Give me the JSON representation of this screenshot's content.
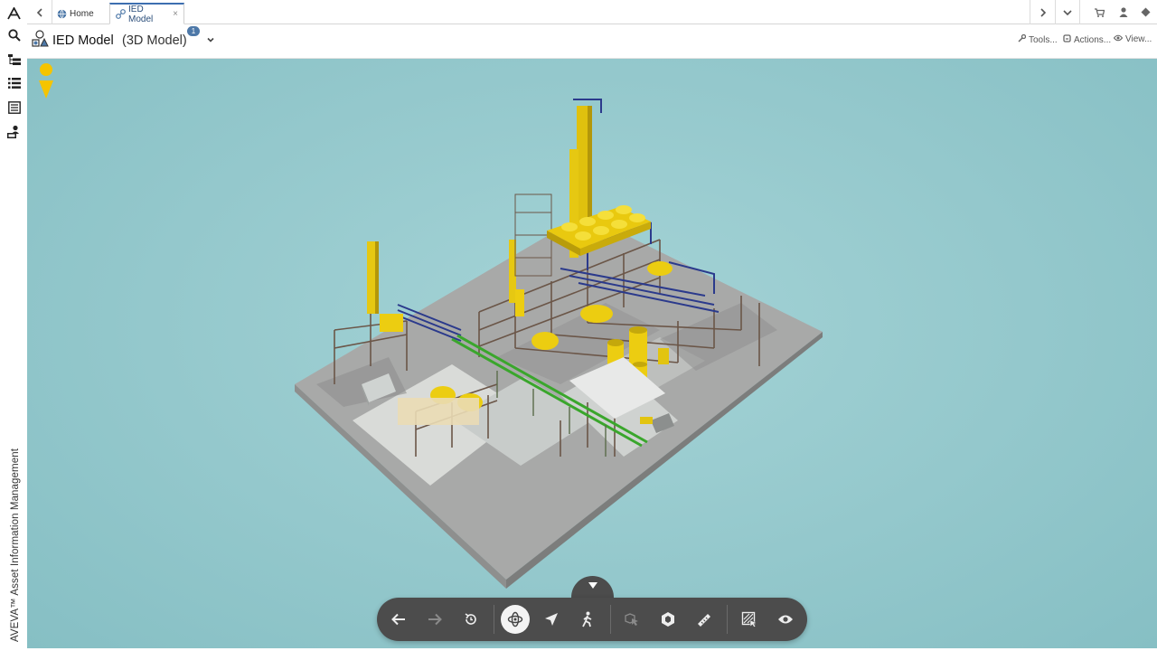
{
  "app": {
    "vertical_brand": "AVEVA™ Asset Information Management"
  },
  "tabs": [
    {
      "label": "Home",
      "icon": "globe-icon",
      "active": false
    },
    {
      "label": "IED Model",
      "icon": "model-link-icon",
      "active": true,
      "close": "×"
    }
  ],
  "header": {
    "title": "IED Model",
    "subtitle": "(3D Model)",
    "badge": "1",
    "menus": {
      "tools": "Tools...",
      "actions": "Actions...",
      "view": "View..."
    }
  },
  "rail_icons": [
    "aveva-logo-icon",
    "search-icon",
    "hierarchy-icon",
    "list-icon",
    "document-list-icon",
    "user-document-icon"
  ],
  "toolbar": {
    "buttons": [
      {
        "name": "back-icon",
        "active": false,
        "enabled": true
      },
      {
        "name": "forward-icon",
        "active": false,
        "enabled": false
      },
      {
        "name": "reset-view-icon",
        "active": false,
        "enabled": true
      },
      {
        "name": "orbit-icon",
        "active": true,
        "enabled": true
      },
      {
        "name": "fly-icon",
        "active": false,
        "enabled": true
      },
      {
        "name": "walk-icon",
        "active": false,
        "enabled": true
      },
      {
        "name": "select-objects-icon",
        "active": false,
        "enabled": false
      },
      {
        "name": "model-box-icon",
        "active": false,
        "enabled": true
      },
      {
        "name": "measure-icon",
        "active": false,
        "enabled": true
      },
      {
        "name": "section-select-icon",
        "active": false,
        "enabled": true
      },
      {
        "name": "visibility-icon",
        "active": false,
        "enabled": true
      }
    ]
  },
  "colors": {
    "viewport_bg": "#94c8cc",
    "toolbar_bg": "#4c4c4c",
    "accent": "#3d6fb0",
    "equipment": "#f2cf12",
    "pegman": "#f5c400"
  }
}
